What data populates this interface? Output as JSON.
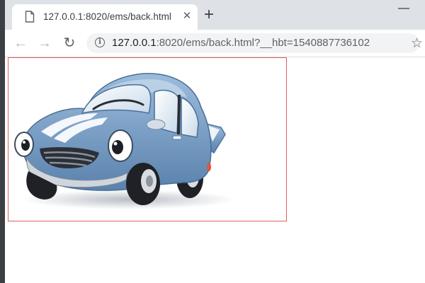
{
  "browser": {
    "tab": {
      "title": "127.0.0.1:8020/ems/back.html",
      "close_glyph": "✕",
      "icon": "file-icon"
    },
    "new_tab_glyph": "+",
    "minimize_glyph": "—",
    "toolbar": {
      "back_glyph": "←",
      "forward_glyph": "→",
      "reload_glyph": "↻",
      "star_glyph": "☆"
    },
    "address_bar": {
      "host": "127.0.0.1",
      "rest": ":8020/ems/back.html?__hbt=1540887736102"
    }
  },
  "page": {
    "image": {
      "subject": "car-illustration",
      "border_color": "#e06060",
      "body_color": "#7fa3c8"
    }
  }
}
